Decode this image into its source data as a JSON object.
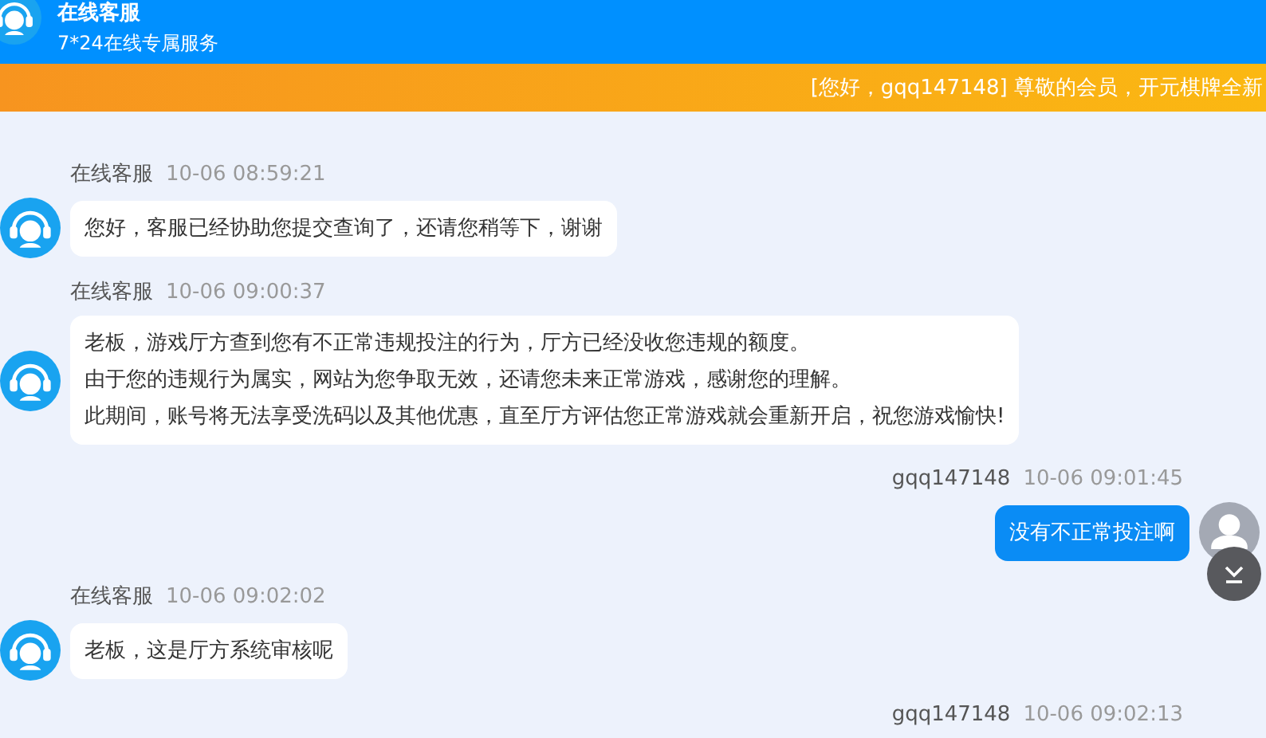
{
  "header": {
    "title": "在线客服",
    "subtitle": "7*24在线专属服务"
  },
  "notice": {
    "text": "[您好，gqq147148] 尊敬的会员，开元棋牌全新"
  },
  "messages": [
    {
      "kind": "agent",
      "name": "在线客服",
      "time": "10-06 08:59:21",
      "text": "您好，客服已经协助您提交查询了，还请您稍等下，谢谢"
    },
    {
      "kind": "agent",
      "name": "在线客服",
      "time": "10-06 09:00:37",
      "lines": [
        "老板，游戏厅方查到您有不正常违规投注的行为，厅方已经没收您违规的额度。",
        "由于您的违规行为属实，网站为您争取无效，还请您未来正常游戏，感谢您的理解。",
        "此期间，账号将无法享受洗码以及其他优惠，直至厅方评估您正常游戏就会重新开启，祝您游戏愉快!"
      ]
    },
    {
      "kind": "user",
      "name": "gqq147148",
      "time": "10-06 09:01:45",
      "text": "没有不正常投注啊"
    },
    {
      "kind": "agent",
      "name": "在线客服",
      "time": "10-06 09:02:02",
      "text": "老板，这是厅方系统审核呢"
    },
    {
      "kind": "user",
      "name": "gqq147148",
      "time": "10-06 09:02:13"
    }
  ]
}
